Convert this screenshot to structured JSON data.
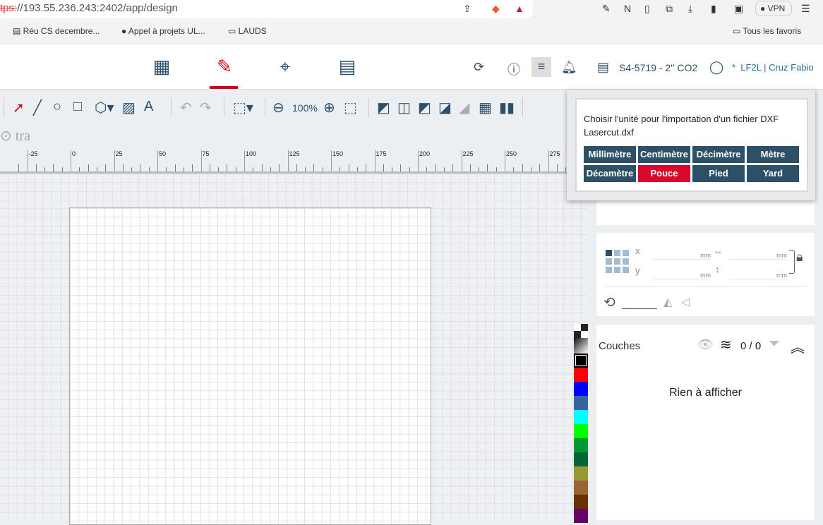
{
  "browser": {
    "url_scheme": "tps:",
    "url": "//193.55.236.243:2402/app/design",
    "vpn": "VPN",
    "bookmarks": [
      "Réu CS decembre...",
      "Appel à projets UL...",
      "LAUDS"
    ],
    "all_favorites": "Tous les favoris"
  },
  "header": {
    "nav": [
      "apps-icon",
      "design-icon",
      "target-icon",
      "machine-icon"
    ],
    "active": "design",
    "machine": "S4-5719 - 2'' CO2",
    "asterisk": "*",
    "org": "LF2L",
    "separator": "|",
    "user": "Cruz Fabio"
  },
  "toolbar": {
    "zoom": "100%"
  },
  "canvas": {
    "partial_text": "tra",
    "ruler": {
      "start": -25,
      "end": 275,
      "step": 25
    }
  },
  "palette": [
    "#000000",
    "#ff0000",
    "#0000ff",
    "#336699",
    "#00ffff",
    "#00ff00",
    "#009933",
    "#006633",
    "#999933",
    "#996633",
    "#663300",
    "#660066"
  ],
  "transform": {
    "x_label": "x",
    "y_label": "y",
    "unit": "mm"
  },
  "layers": {
    "title": "Couches",
    "count": "0 / 0",
    "empty": "Rien à afficher"
  },
  "dialog": {
    "message": "Choisir l'unité pour l'importation d'un fichier DXF",
    "filename": "Lasercut.dxf",
    "units": [
      "Millimètre",
      "Centimètre",
      "Décimètre",
      "Mètre",
      "Décamètre",
      "Pouce",
      "Pied",
      "Yard"
    ],
    "selected": "Pouce",
    "accent": "#d8092a",
    "button_color": "#2d5069"
  }
}
